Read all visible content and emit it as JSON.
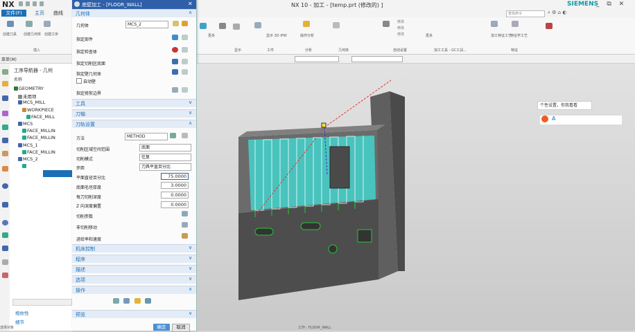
{
  "window": {
    "logo": "NX",
    "title": "NX 10 - 加工 - [temp.prt  (修改的) ]",
    "brand": "SIEMENS",
    "controls": "_ ⧉ ✕"
  },
  "tabs": {
    "file": "文件(F)",
    "home": "主页",
    "curve": "曲线"
  },
  "command_finder": "查找命令",
  "ribbon": {
    "groups": [
      "插入",
      "显示",
      "工件",
      "分析",
      "几何体",
      "自动设置",
      "加工工具 - GC工具...",
      "特征"
    ],
    "buttons": [
      "创建刀具",
      "创建几何体",
      "创建工序",
      "更多",
      "显示 3D IPW",
      "操作分析",
      "加工特征工艺",
      "特征学工艺",
      "更多"
    ],
    "small_items": [
      "修改",
      "修改",
      "修改"
    ]
  },
  "menu": "菜单(M)",
  "navigator": {
    "title": "工序导航器 - 几何",
    "column": "名称",
    "items": [
      {
        "label": "GEOMETRY",
        "indent": 0
      },
      {
        "label": "未用项",
        "indent": 1
      },
      {
        "label": "MCS_MILL",
        "indent": 1
      },
      {
        "label": "WORKPIECE",
        "indent": 2
      },
      {
        "label": "FACE_MILL",
        "indent": 3
      },
      {
        "label": "MCS",
        "indent": 1
      },
      {
        "label": "FACE_MILLIN",
        "indent": 2
      },
      {
        "label": "FACE_MILLIN",
        "indent": 2
      },
      {
        "label": "MCS_1",
        "indent": 1
      },
      {
        "label": "FACE_MILLIN",
        "indent": 2
      },
      {
        "label": "MCS_2",
        "indent": 1
      },
      {
        "label": "FLOOR_WALL",
        "indent": 2
      }
    ],
    "footer": [
      "相依性",
      "细节"
    ]
  },
  "dialog": {
    "title": "底壁加工 - [FLOOR_WALL]",
    "sections": {
      "geometry": "几何体",
      "tool": "工具",
      "axis": "刀轴",
      "cut": "刀轨设置",
      "machine": "机床控制",
      "program": "程序",
      "desc": "描述",
      "options": "选项",
      "actions": "操作",
      "preview": "预览"
    },
    "geometry_rows": {
      "geom_label": "几何体",
      "geom_value": "MCS_2",
      "part": "指定部件",
      "check": "指定检查体",
      "cut_region": "指定切削区底面",
      "wall": "指定壁几何体",
      "auto_wall": "自动壁",
      "trim": "指定修剪边界"
    },
    "cut_rows": {
      "method_label": "方法",
      "method_value": "METHOD",
      "region_label": "切削区域空间范围",
      "region_value": "底面",
      "pattern_label": "切削模式",
      "pattern_value": "往复",
      "step_label": "步距",
      "step_value": "刀具平直百分比",
      "pct_label": "平面直径百分比",
      "pct_value": "75.0000",
      "floor_label": "底面毛坯厚度",
      "floor_value": "3.0000",
      "cutdepth_label": "每刀切削深度",
      "cutdepth_value": "0.0000",
      "zdepth_label": "Z 向深度偏置",
      "zdepth_value": "0.0000",
      "params": "切削参数",
      "noncut": "非切削移动",
      "feeds": "进给率和速度"
    },
    "ok": "确定",
    "cancel": "取消"
  },
  "viewport": {
    "tooltip": "个性设置，你我看看",
    "ime": "A"
  },
  "status": {
    "left": "选择对象",
    "mid": "工作 : FLOOR_WALL"
  },
  "colors": {
    "accent": "#1b6fb7",
    "dialog_title": "#2e5fa8",
    "toolpath": "#3ee0d8",
    "part": "#6b6b6b"
  }
}
